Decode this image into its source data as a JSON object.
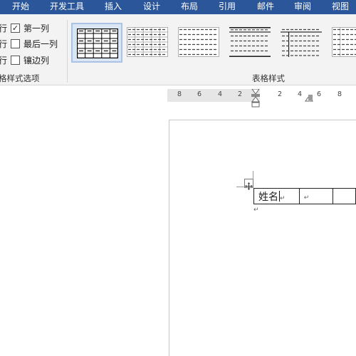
{
  "ribbon": {
    "tabs": [
      {
        "label": "开始"
      },
      {
        "label": "开发工具"
      },
      {
        "label": "插入"
      },
      {
        "label": "设计"
      },
      {
        "label": "布局"
      },
      {
        "label": "引用"
      },
      {
        "label": "邮件"
      },
      {
        "label": "审阅"
      },
      {
        "label": "视图"
      }
    ],
    "colors": {
      "tab_bar": "#2b579a",
      "ribbon_bg": "#f3f3f3",
      "selected_style": "#dbe6f4"
    }
  },
  "style_options": {
    "row_prefix": "行",
    "items": [
      {
        "label": "第一列",
        "checked": true,
        "mark": "✓"
      },
      {
        "label": "最后一列",
        "checked": false,
        "mark": ""
      },
      {
        "label": "镶边列",
        "checked": false,
        "mark": ""
      }
    ],
    "group_label": "格样式选项"
  },
  "table_styles": {
    "group_label": "表格样式",
    "selected_index": 0,
    "count": 6
  },
  "ruler": {
    "labels": [
      "8",
      "6",
      "4",
      "2",
      "2",
      "4",
      "6",
      "8"
    ]
  },
  "document": {
    "table": {
      "cells": [
        {
          "text": "姓名",
          "mark": "↵"
        },
        {
          "text": "",
          "mark": "↵"
        },
        {
          "text": "",
          "mark": ""
        }
      ]
    },
    "paragraph_mark": "↵"
  }
}
